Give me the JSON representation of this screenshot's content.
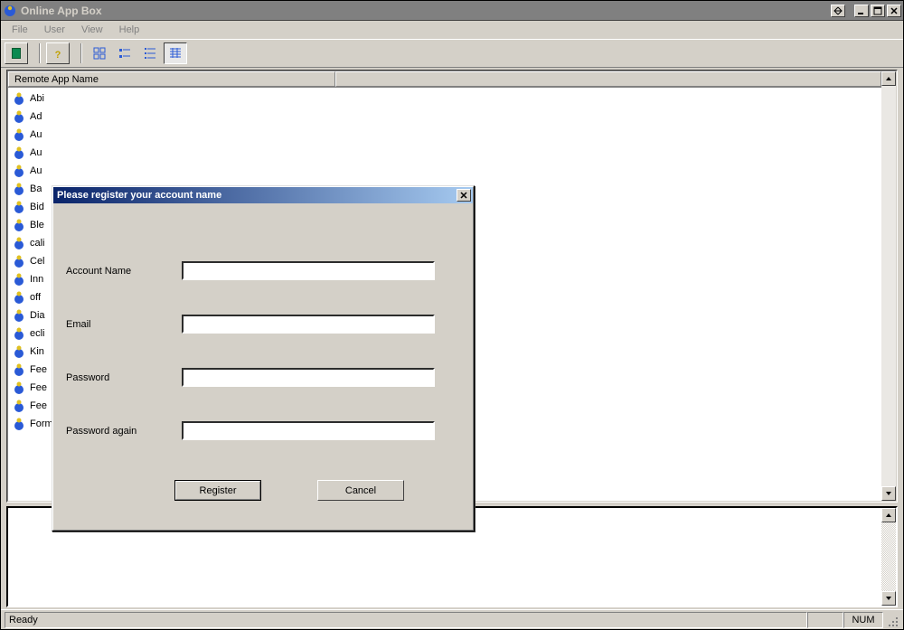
{
  "window": {
    "title": "Online App Box",
    "titlebar_buttons": [
      "resize",
      "minimize",
      "maximize",
      "close"
    ]
  },
  "menu": {
    "items": [
      "File",
      "User",
      "View",
      "Help"
    ]
  },
  "toolbar": {
    "buttons": [
      {
        "name": "book-icon"
      },
      {
        "name": "help-icon"
      },
      {
        "name": "view-large-icon"
      },
      {
        "name": "view-small-icon"
      },
      {
        "name": "view-list-icon"
      },
      {
        "name": "view-details-icon",
        "active": true
      }
    ]
  },
  "list": {
    "columns": [
      "Remote App Name",
      ""
    ],
    "items": [
      "Abi",
      "Ad",
      "Au",
      "Au",
      "Au",
      "Ba",
      "Bid",
      "Ble",
      "cali",
      "Cel",
      "Inn",
      "off",
      "Dia",
      "ecli",
      "Kin",
      "Fee",
      "Fee",
      "Fee",
      "FormatFactory"
    ]
  },
  "statusbar": {
    "left": "Ready",
    "numlock": "NUM"
  },
  "dialog": {
    "title": "Please register your account name",
    "fields": {
      "account_label": "Account Name",
      "email_label": "Email",
      "password_label": "Password",
      "password2_label": "Password again",
      "account_value": "",
      "email_value": "",
      "password_value": "",
      "password2_value": ""
    },
    "buttons": {
      "register": "Register",
      "cancel": "Cancel"
    }
  }
}
